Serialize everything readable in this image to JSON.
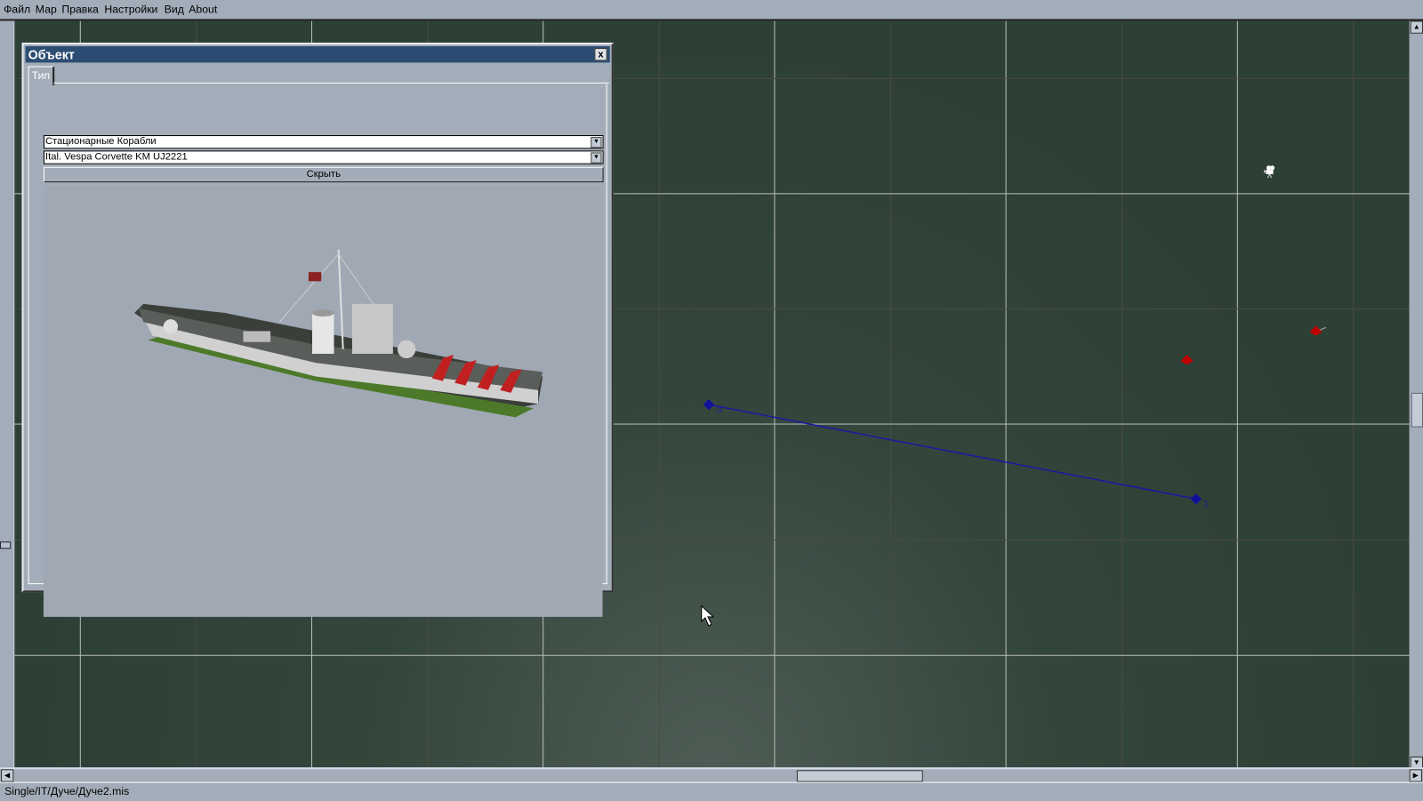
{
  "menu": [
    "Файл",
    "Мар",
    "Правка",
    "Настройки",
    "Вид",
    "About"
  ],
  "dialog": {
    "title": "Объект",
    "close_label": "x",
    "tab": "Тип",
    "category_select": "Стационарные Корабли",
    "object_select": "Ital. Vespa Corvette KM UJ2221",
    "hide_button": "Скрыть"
  },
  "map": {
    "waypoints": [
      {
        "label": "0"
      },
      {
        "label": "1"
      }
    ],
    "route_color": "#1a1aa0",
    "enemy_color": "#c00000"
  },
  "status": {
    "path": "Single/IT/Дуче/Дуче2.mis"
  }
}
